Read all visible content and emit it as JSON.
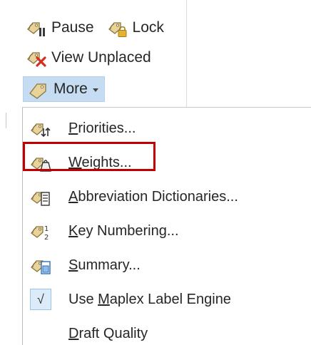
{
  "ribbon": {
    "pause_label": "Pause",
    "lock_label": "Lock",
    "view_unplaced_label": "View Unplaced",
    "more_label": "More"
  },
  "menu": {
    "items": [
      {
        "prefix": "",
        "accel": "P",
        "rest": "riorities...",
        "icon": "priorities-icon"
      },
      {
        "prefix": "",
        "accel": "W",
        "rest": "eights...",
        "icon": "weights-icon"
      },
      {
        "prefix": "",
        "accel": "A",
        "rest": "bbreviation Dictionaries...",
        "icon": "abbreviation-dictionaries-icon"
      },
      {
        "prefix": "",
        "accel": "K",
        "rest": "ey Numbering...",
        "icon": "key-numbering-icon"
      },
      {
        "prefix": "",
        "accel": "S",
        "rest": "ummary...",
        "icon": "summary-icon"
      },
      {
        "prefix": "Use ",
        "accel": "M",
        "rest": "aplex Label Engine",
        "icon": "checkmark-icon",
        "checked": true
      },
      {
        "prefix": "",
        "accel": "D",
        "rest": "raft Quality",
        "icon": ""
      }
    ],
    "check_glyph": "√"
  },
  "colors": {
    "more_button_bg": "#c5dcf2",
    "highlight_border": "#c00000",
    "tag_fill": "#e8d49a",
    "tag_stroke": "#8a7640"
  }
}
